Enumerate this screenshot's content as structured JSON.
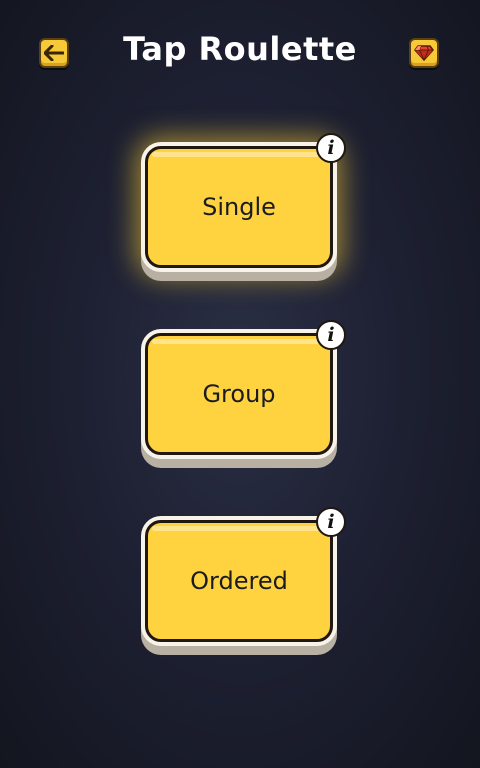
{
  "header": {
    "title": "Tap Roulette",
    "back_icon": "arrow-left-icon",
    "gem_icon": "diamond-icon"
  },
  "modes": [
    {
      "label": "Single",
      "selected": true,
      "info_label": "i"
    },
    {
      "label": "Group",
      "selected": false,
      "info_label": "i"
    },
    {
      "label": "Ordered",
      "selected": false,
      "info_label": "i"
    }
  ],
  "colors": {
    "background": "#1e2133",
    "card_fill": "#ffd23f",
    "card_outline": "#f8f3e9",
    "icon_button_fill": "#f5c937",
    "title_text": "#ffffff"
  }
}
